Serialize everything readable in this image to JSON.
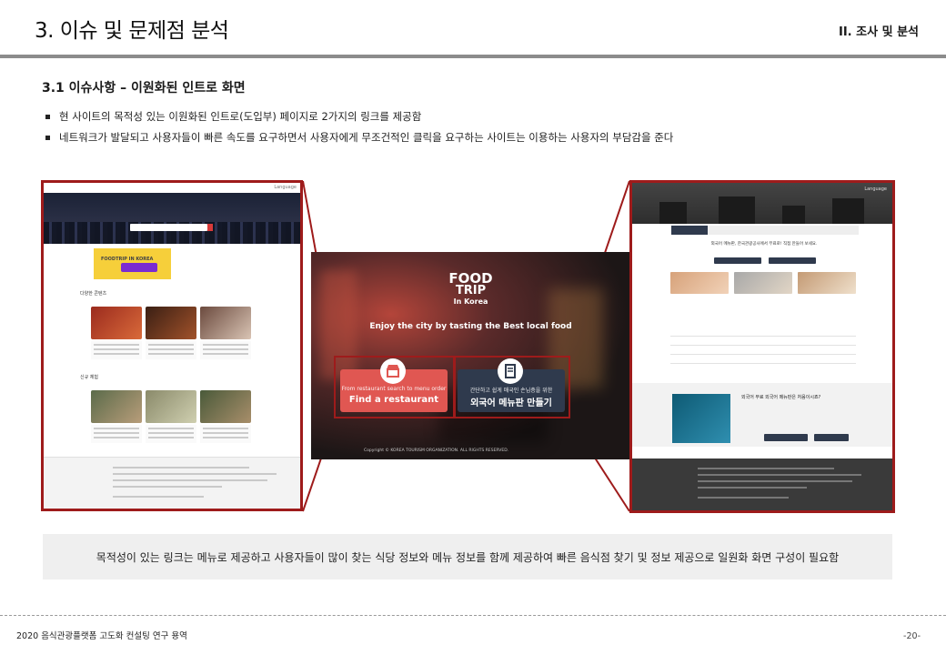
{
  "header": {
    "title": "3. 이슈 및 문제점 분석",
    "section_tag": "II.   조사 및 분석"
  },
  "section": {
    "subtitle": "3.1 이슈사항 – 이원화된 인트로 화면",
    "bullets": [
      "현 사이트의 목적성 있는 이원화된 인트로(도입부) 페이지로 2가지의 링크를 제공함",
      "네트워크가 발달되고 사용자들이 빠른 속도를 요구하면서 사용자에게 무조건적인 클릭을 요구하는 사이트는 이용하는 사용자의 부담감을 준다"
    ]
  },
  "left_screenshot": {
    "top_link": "Language",
    "banner_text": "FOODTRIP IN KOREA",
    "banner_big": "사용설명서",
    "section_1": "다양한 콘텐츠",
    "section_2": "신규 체험"
  },
  "center_screenshot": {
    "logo_line1": "FOOD",
    "logo_line2": "TRIP",
    "logo_line3": "In Korea",
    "tagline": "Enjoy the city by tasting the Best local food",
    "button_restaurant": {
      "small": "From restaurant search to menu order",
      "main": "Find a restaurant",
      "icon": "store-icon"
    },
    "button_menu": {
      "small": "간단하고 쉽게 매국인 손님층을 위한",
      "main": "외국어 메뉴판 만들기",
      "icon": "menu-board-icon"
    },
    "copyright": "Copyright © KOREA TOURISM ORGANIZATION. ALL RIGHTS RESERVED."
  },
  "right_screenshot": {
    "top_link": "Language",
    "notice": "외국어 메뉴판, 한국관광공사에서 무료로! 직접 만들어 보세요.",
    "video_title": "외국어 무료 외국어 메뉴판은 처음이시죠?",
    "cta_1": "외국어 메뉴판 만들기",
    "cta_2": "메뉴판 내려받기"
  },
  "summary": "목적성이 있는 링크는 메뉴로 제공하고 사용자들이 많이 찾는 식당 정보와 메뉴 정보를 함께 제공하여 빠른 음식점 찾기 및 정보 제공으로 일원화 화면 구성이 필요함",
  "footer": {
    "left": "2020 음식관광플랫폼 고도화 컨설팅 연구 용역",
    "page": "-20-"
  },
  "colors": {
    "accent_border": "#9e1b1b",
    "restaurant_button": "#e05752",
    "menu_button": "#2f3a4d"
  }
}
